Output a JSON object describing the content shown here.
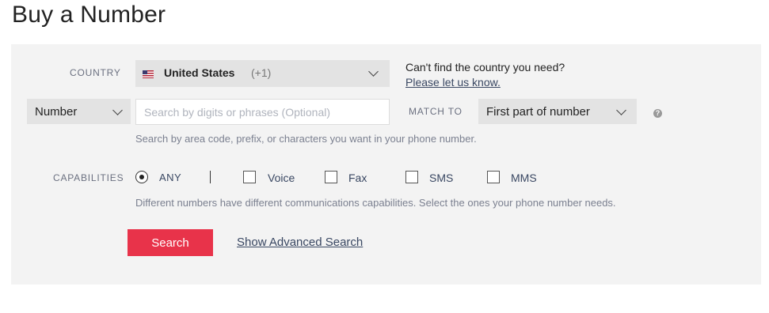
{
  "page": {
    "title": "Buy a Number"
  },
  "country": {
    "label": "COUNTRY",
    "selected_name": "United States",
    "selected_code": "(+1)",
    "flag": "us-flag-icon"
  },
  "help_link": {
    "question": "Can't find the country you need?",
    "link_text": "Please let us know."
  },
  "search": {
    "type_selected": "Number",
    "placeholder": "Search by digits or phrases (Optional)",
    "value": "",
    "match_label": "MATCH TO",
    "match_selected": "First part of number",
    "help_text": "Search by area code, prefix, or characters you want in your phone number."
  },
  "capabilities": {
    "label": "CAPABILITIES",
    "options": [
      {
        "label": "ANY",
        "type": "radio",
        "checked": true
      },
      {
        "label": "Voice",
        "type": "checkbox",
        "checked": false
      },
      {
        "label": "Fax",
        "type": "checkbox",
        "checked": false
      },
      {
        "label": "SMS",
        "type": "checkbox",
        "checked": false
      },
      {
        "label": "MMS",
        "type": "checkbox",
        "checked": false
      }
    ],
    "help_text": "Different numbers have different communications capabilities. Select the ones your phone number needs."
  },
  "actions": {
    "search_button": "Search",
    "advanced_link": "Show Advanced Search"
  },
  "colors": {
    "accent": "#e8334a",
    "panel_bg": "#f3f3f3",
    "text": "#394762"
  }
}
